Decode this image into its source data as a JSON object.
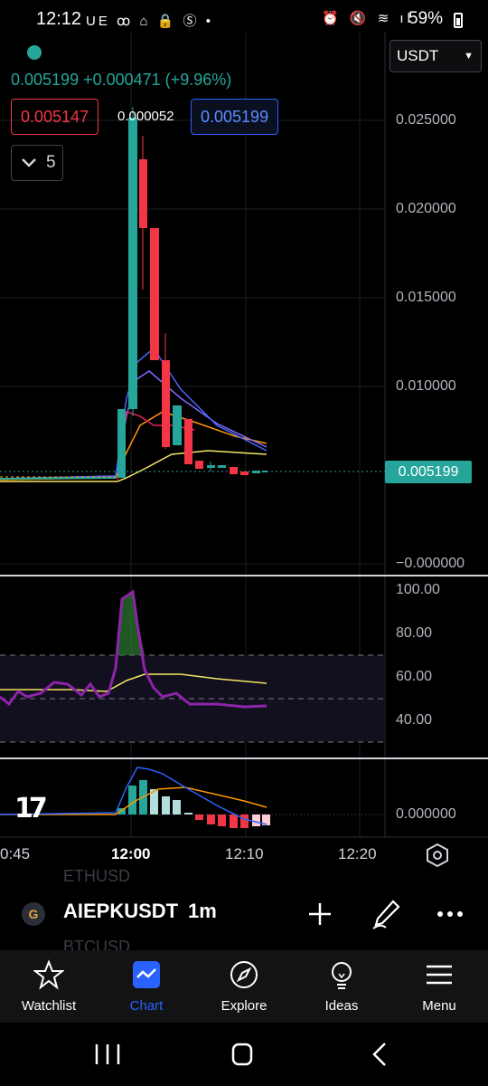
{
  "status_bar": {
    "time": "12:12",
    "left_icons": "UE ꝏ ⌂ 🔒 Ⓢ •",
    "right_icons": "⏰ 🔇 ≋ ıl",
    "battery": "59%"
  },
  "header": {
    "price": "0.005199",
    "change": "+0.000471 (+9.96%)",
    "bid": "0.005147",
    "spread": "0.000052",
    "ask": "0.005199",
    "indicators_count": "5",
    "currency": "USDT"
  },
  "price_axis": [
    "0.025000",
    "0.020000",
    "0.015000",
    "0.010000",
    "−0.000000"
  ],
  "last_price_label": "0.005199",
  "rsi_axis": [
    "100.00",
    "80.00",
    "60.00",
    "40.00"
  ],
  "macd_axis": [
    "0.000000"
  ],
  "time_axis": [
    "0:45",
    "12:00",
    "12:10",
    "12:20"
  ],
  "watermark": "17",
  "symbol_bar": {
    "ghost_above": "ETHUSD",
    "ghost_below": "BTCUSD",
    "symbol": "AIEPKUSDT",
    "timeframe": "1m",
    "logo": "G",
    "add_icon": "plus-icon",
    "draw_icon": "pen-icon",
    "more_icon": "more-icon"
  },
  "nav": [
    {
      "label": "Watchlist",
      "icon": "star-icon"
    },
    {
      "label": "Chart",
      "icon": "chart-icon"
    },
    {
      "label": "Explore",
      "icon": "compass-icon"
    },
    {
      "label": "Ideas",
      "icon": "lightbulb-icon"
    },
    {
      "label": "Menu",
      "icon": "menu-icon"
    }
  ],
  "colors": {
    "up": "#26a69a",
    "down": "#f23645",
    "accent": "#2962ff",
    "rsi": "#8e24aa",
    "ma_yellow": "#f5e663",
    "ma_orange": "#ff9800",
    "ma_blue": "#5b6cff"
  }
}
